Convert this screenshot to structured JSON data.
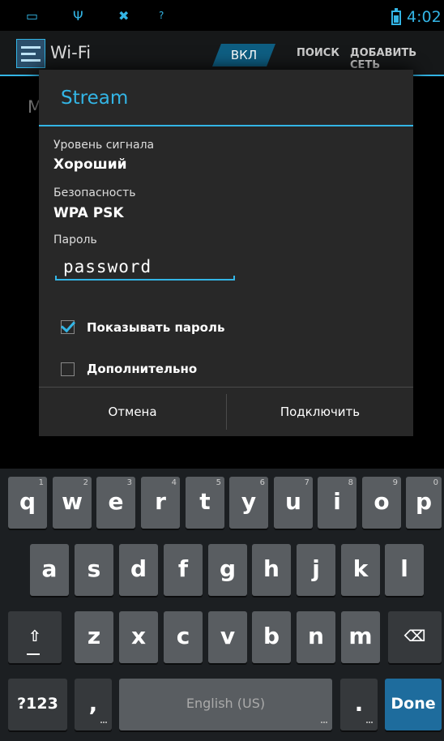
{
  "status_bar": {
    "icons": [
      "keyboard-icon",
      "usb-icon",
      "debug-icon",
      "wifi-question-icon"
    ],
    "time": "4:02"
  },
  "action_bar": {
    "title": "Wi-Fi",
    "toggle_label": "ВКЛ",
    "actions": [
      "ПОИСК",
      "ДОБАВИТЬ СЕТЬ"
    ]
  },
  "background_fragment": "M",
  "dialog": {
    "title": "Stream",
    "signal_label": "Уровень сигнала",
    "signal_value": "Хороший",
    "security_label": "Безопасность",
    "security_value": "WPA PSK",
    "password_label": "Пароль",
    "password_value": "password",
    "show_password_label": "Показывать пароль",
    "show_password_checked": true,
    "advanced_label": "Дополнительно",
    "advanced_checked": false,
    "cancel_label": "Отмена",
    "connect_label": "Подключить"
  },
  "keyboard": {
    "row1": [
      {
        "key": "q",
        "hint": "1"
      },
      {
        "key": "w",
        "hint": "2"
      },
      {
        "key": "e",
        "hint": "3"
      },
      {
        "key": "r",
        "hint": "4"
      },
      {
        "key": "t",
        "hint": "5"
      },
      {
        "key": "y",
        "hint": "6"
      },
      {
        "key": "u",
        "hint": "7"
      },
      {
        "key": "i",
        "hint": "8"
      },
      {
        "key": "o",
        "hint": "9"
      },
      {
        "key": "p",
        "hint": "0"
      }
    ],
    "row2": [
      "a",
      "s",
      "d",
      "f",
      "g",
      "h",
      "j",
      "k",
      "l"
    ],
    "row3": [
      "z",
      "x",
      "c",
      "v",
      "b",
      "n",
      "m"
    ],
    "shift_symbol": "⇧",
    "backspace_symbol": "⌫",
    "symbols_label": "?123",
    "comma_label": ",",
    "space_label": "English (US)",
    "period_label": ".",
    "done_label": "Done"
  },
  "colors": {
    "accent": "#33b5e5",
    "dialog_bg": "#282828",
    "key_bg": "#595d61",
    "done_key_bg": "#1e6c9d"
  }
}
